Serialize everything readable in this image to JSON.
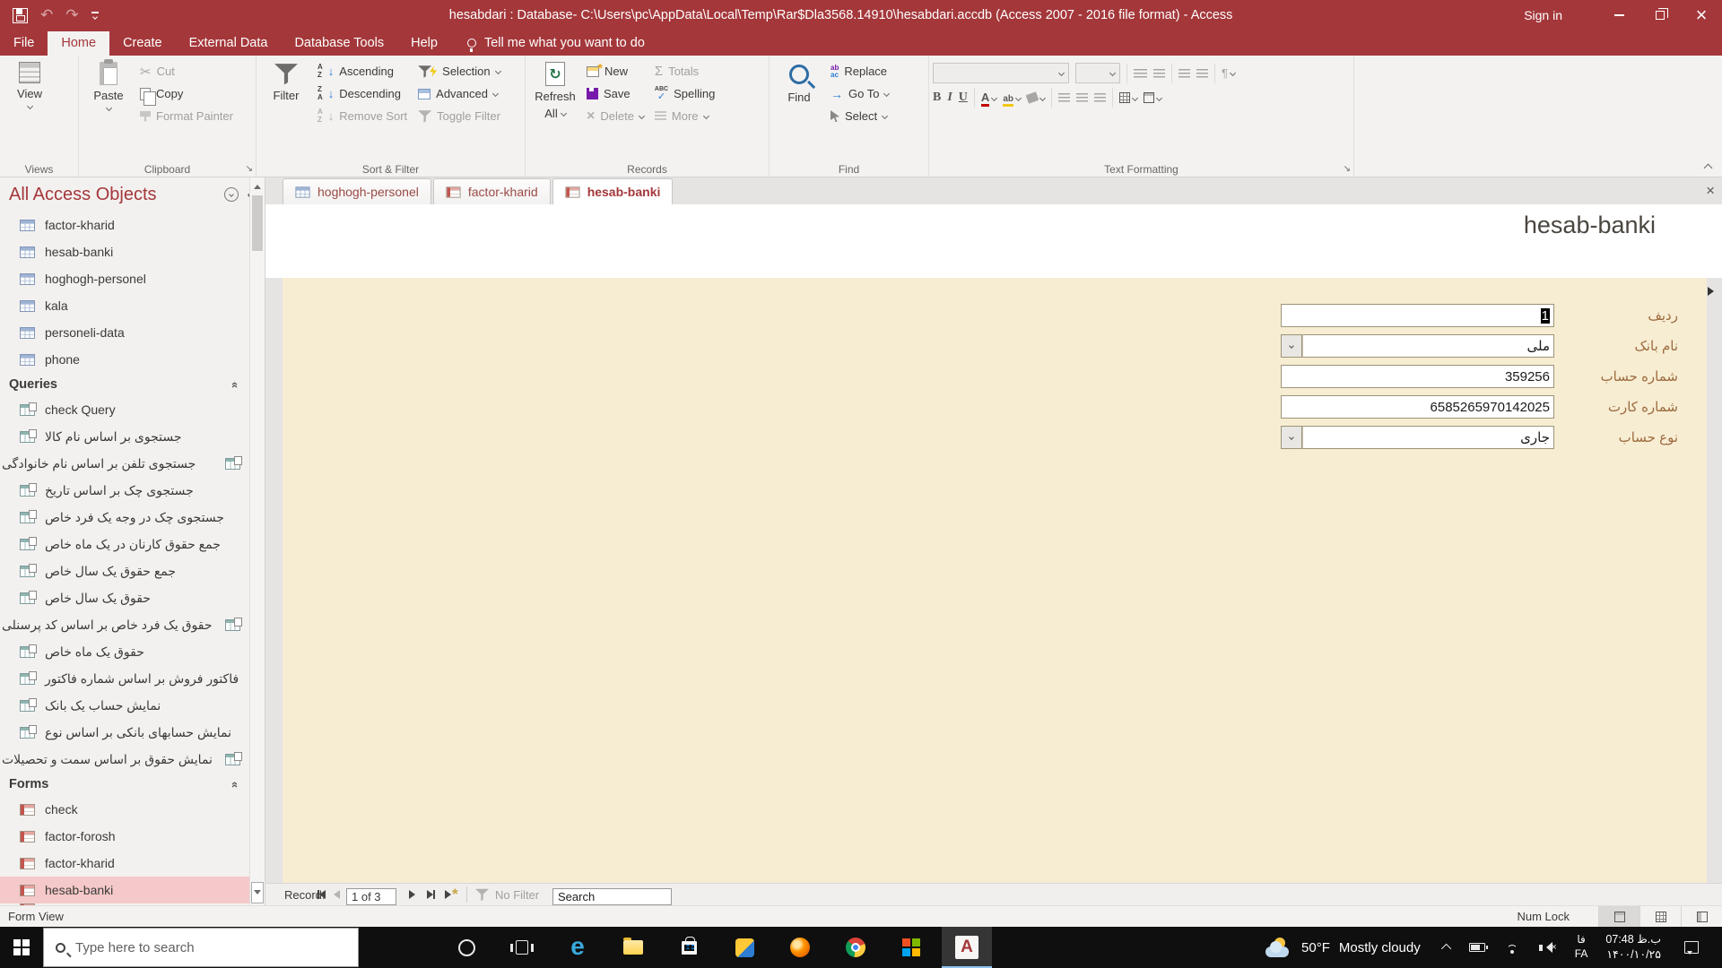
{
  "window": {
    "title": "hesabdari : Database- C:\\Users\\pc\\AppData\\Local\\Temp\\Rar$Dla3568.14910\\hesabdari.accdb (Access 2007 - 2016 file format)  -  Access",
    "sign_in": "Sign in"
  },
  "menu_tabs": [
    {
      "label": "File"
    },
    {
      "label": "Home",
      "active": true
    },
    {
      "label": "Create"
    },
    {
      "label": "External Data"
    },
    {
      "label": "Database Tools"
    },
    {
      "label": "Help"
    }
  ],
  "tell_me": "Tell me what you want to do",
  "ribbon": {
    "views": {
      "group": "Views",
      "view": "View"
    },
    "clipboard": {
      "group": "Clipboard",
      "paste": "Paste",
      "cut": "Cut",
      "copy": "Copy",
      "format_painter": "Format Painter"
    },
    "sort_filter": {
      "group": "Sort & Filter",
      "filter": "Filter",
      "ascending": "Ascending",
      "descending": "Descending",
      "remove_sort": "Remove Sort",
      "selection": "Selection",
      "advanced": "Advanced",
      "toggle_filter": "Toggle Filter"
    },
    "records": {
      "group": "Records",
      "refresh_l1": "Refresh",
      "refresh_l2": "All",
      "new": "New",
      "save": "Save",
      "delete": "Delete",
      "totals": "Totals",
      "spelling": "Spelling",
      "more": "More"
    },
    "find": {
      "group": "Find",
      "find": "Find",
      "replace": "Replace",
      "go_to": "Go To",
      "select": "Select"
    },
    "text_formatting": {
      "group": "Text Formatting",
      "bold": "B",
      "italic": "I",
      "underline": "U"
    }
  },
  "nav_pane": {
    "header": "All Access Objects",
    "tables": [
      "factor-kharid",
      "hesab-banki",
      "hoghogh-personel",
      "kala",
      "personeli-data",
      "phone"
    ],
    "queries_header": "Queries",
    "queries": [
      {
        "label": "check Query"
      },
      {
        "label": "جستجوی بر اساس نام کالا"
      },
      {
        "label": "جستجوی تلفن بر اساس نام خانوادگی",
        "flip": true
      },
      {
        "label": "جستجوی چک بر اساس تاریخ"
      },
      {
        "label": "جستجوی چک در وجه یک فرد خاص"
      },
      {
        "label": "جمع حقوق کارنان در یک ماه خاص"
      },
      {
        "label": "جمع حقوق یک سال خاص"
      },
      {
        "label": "حقوق یک سال خاص"
      },
      {
        "label": "حقوق یک فرد خاص بر اساس کد پرسنلی",
        "flip": true
      },
      {
        "label": "حقوق یک ماه خاص"
      },
      {
        "label": "فاکتور فروش بر اساس شماره فاکتور"
      },
      {
        "label": "نمایش حساب یک بانک"
      },
      {
        "label": "نمایش حسابهای بانکی بر اساس نوع"
      },
      {
        "label": "نمایش حقوق بر اساس سمت و تحصیلات",
        "flip": true
      }
    ],
    "forms_header": "Forms",
    "forms": [
      {
        "label": "check"
      },
      {
        "label": "factor-forosh"
      },
      {
        "label": "factor-kharid"
      },
      {
        "label": "hesab-banki",
        "selected": true
      }
    ]
  },
  "doc": {
    "tabs": [
      {
        "label": "hoghogh-personel",
        "icon": "table"
      },
      {
        "label": "factor-kharid",
        "icon": "form"
      },
      {
        "label": "hesab-banki",
        "icon": "form",
        "active": true
      }
    ],
    "form_title": "hesab-banki",
    "fields": [
      {
        "label": "ردیف",
        "value": "1",
        "text_selected": true
      },
      {
        "label": "نام بانک",
        "value": "ملی",
        "combo": true
      },
      {
        "label": "شماره حساب",
        "value": "359256"
      },
      {
        "label": "شماره کارت",
        "value": "6585265970142025"
      },
      {
        "label": "نوع حساب",
        "value": "جاری",
        "combo": true
      }
    ]
  },
  "record_bar": {
    "label": "Record:",
    "position": "1 of 3",
    "no_filter": "No Filter",
    "search": "Search"
  },
  "status_bar": {
    "view_mode": "Form View",
    "num_lock": "Num Lock"
  },
  "taskbar": {
    "search_placeholder": "Type here to search",
    "app_icons": [
      "start",
      "cortana",
      "task-view",
      "edge",
      "file-explorer",
      "store",
      "media-app",
      "firefox",
      "chrome",
      "microsoft-app",
      "access"
    ],
    "weather_temp": "50°F",
    "weather_text": "Mostly cloudy",
    "lang_top": "فا",
    "lang_bottom": "FA",
    "time": "07:48 ب.ظ",
    "date": "۱۴۰۰/۱۰/۲۵"
  },
  "colors": {
    "accent": "#A4373A",
    "form_bg": "#F7EDD3",
    "selected_pink": "#F5C9C9",
    "taskbar_bg": "#0F0F0F"
  }
}
